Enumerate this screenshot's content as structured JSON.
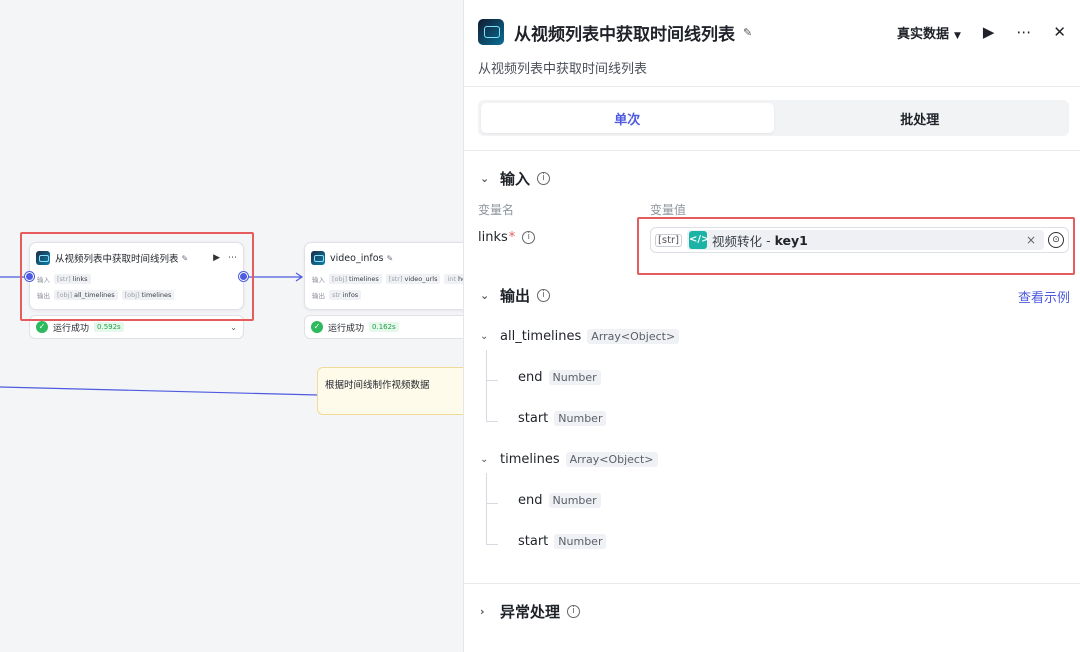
{
  "canvas": {
    "node_main": {
      "title": "从视频列表中获取时间线列表",
      "input_label": "输入",
      "input_type": "[str]",
      "input_name": "links",
      "output_label": "输出",
      "output_type_1": "[obj]",
      "output_name_1": "all_timelines",
      "output_type_2": "[obj]",
      "output_name_2": "timelines"
    },
    "node_main_run": {
      "status": "运行成功",
      "time": "0.592s"
    },
    "node_video": {
      "title": "video_infos",
      "input_label": "输入",
      "input_type_1": "[obj]",
      "input_name_1": "timelines",
      "input_type_2": "[str]",
      "input_name_2": "video_urls",
      "input_type_3": "int",
      "input_name_3": "heig",
      "output_label": "输出",
      "output_type": "str",
      "output_name": "infos"
    },
    "node_video_run": {
      "status": "运行成功",
      "time": "0.162s"
    },
    "note": {
      "text": "根据时间线制作视频数据"
    }
  },
  "panel": {
    "title": "从视频列表中获取时间线列表",
    "subtitle": "从视频列表中获取时间线列表",
    "data_mode": "真实数据",
    "tabs": [
      "单次",
      "批处理"
    ],
    "input_section": "输入",
    "col_name": "变量名",
    "col_value": "变量值",
    "var_name": "links",
    "var_type": "[str]",
    "ref_node": "视频转化",
    "ref_dot": "-",
    "ref_key": "key1",
    "output_section": "输出",
    "view_example": "查看示例",
    "outputs": [
      {
        "name": "all_timelines",
        "type": "Array<Object>",
        "children": [
          {
            "name": "end",
            "type": "Number"
          },
          {
            "name": "start",
            "type": "Number"
          }
        ]
      },
      {
        "name": "timelines",
        "type": "Array<Object>",
        "children": [
          {
            "name": "end",
            "type": "Number"
          },
          {
            "name": "start",
            "type": "Number"
          }
        ]
      }
    ],
    "error_section": "异常处理"
  }
}
